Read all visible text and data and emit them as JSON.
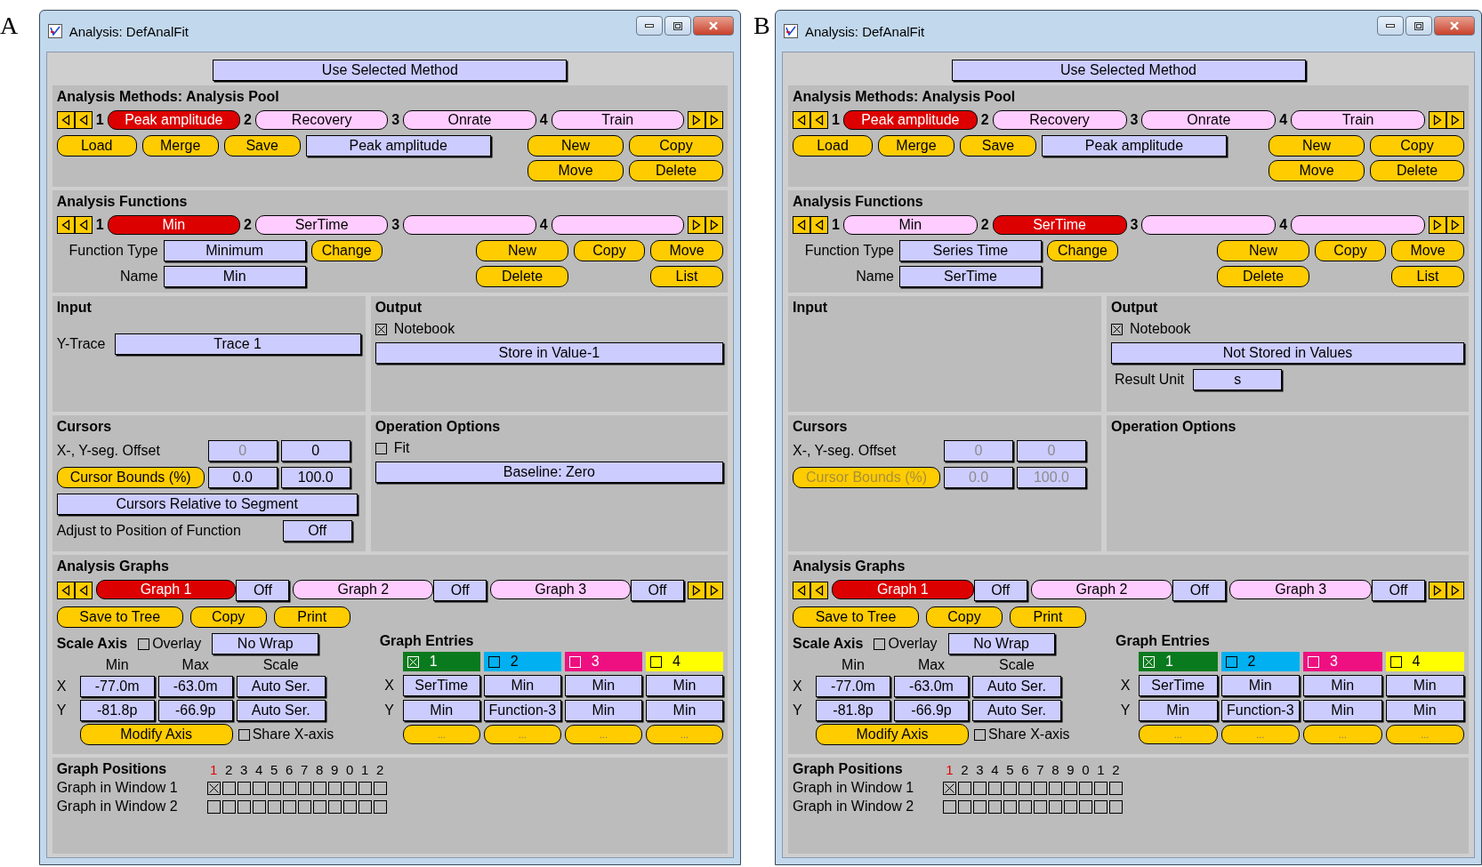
{
  "panels": [
    {
      "label": "A",
      "title": "Analysis:  DefAnalFit",
      "use_method_button": "Use Selected Method",
      "methods": {
        "heading": "Analysis Methods:  Analysis Pool",
        "slots": [
          {
            "number": "1",
            "name": "Peak amplitude",
            "selected": true
          },
          {
            "number": "2",
            "name": "Recovery",
            "selected": false
          },
          {
            "number": "3",
            "name": "Onrate",
            "selected": false
          },
          {
            "number": "4",
            "name": "Train",
            "selected": false
          }
        ],
        "file_buttons": [
          "Load",
          "Merge",
          "Save"
        ],
        "current_name": "Peak amplitude",
        "actions": [
          "New",
          "Copy",
          "Move",
          "Delete"
        ]
      },
      "functions": {
        "heading": "Analysis Functions",
        "slots": [
          {
            "number": "1",
            "name": "Min",
            "selected": true
          },
          {
            "number": "2",
            "name": "SerTime",
            "selected": false
          },
          {
            "number": "3",
            "selected": false
          },
          {
            "number": "4",
            "selected": false
          }
        ],
        "type_label": "Function Type",
        "type_value": "Minimum",
        "change_button": "Change",
        "name_label": "Name",
        "name_value": "Min",
        "actions": [
          "New",
          "Copy",
          "Move",
          "Delete",
          "List"
        ]
      },
      "input": {
        "heading": "Input",
        "fields": [
          {
            "label": "Y-Trace",
            "value": "Trace 1"
          }
        ]
      },
      "output": {
        "heading": "Output",
        "notebook": {
          "label": "Notebook",
          "checked": true
        },
        "store_button": "Store in Value-1"
      },
      "cursors": {
        "heading": "Cursors",
        "offset_label": "X-, Y-seg. Offset",
        "offset_values": [
          {
            "value": "0",
            "disabled": true
          },
          {
            "value": "0",
            "disabled": false
          }
        ],
        "bounds_button": {
          "label": "Cursor Bounds (%)",
          "disabled": false
        },
        "bounds_values": [
          {
            "value": "0.0",
            "disabled": false
          },
          {
            "value": "100.0",
            "disabled": false
          }
        ],
        "relative_button": "Cursors Relative to Segment",
        "adjust": {
          "label": "Adjust to Position of Function",
          "value": "Off"
        }
      },
      "operation": {
        "heading": "Operation Options",
        "fit": {
          "label": "Fit",
          "checked": false
        },
        "baseline_button": "Baseline: Zero"
      },
      "graphs": {
        "heading": "Analysis Graphs",
        "tabs": [
          {
            "name": "Graph 1",
            "toggle": "Off",
            "selected": true
          },
          {
            "name": "Graph 2",
            "toggle": "Off",
            "selected": false
          },
          {
            "name": "Graph 3",
            "toggle": "Off",
            "selected": false
          }
        ],
        "buttons": [
          "Save to Tree",
          "Copy",
          "Print"
        ],
        "scale": {
          "heading": "Scale Axis",
          "overlay": {
            "label": "Overlay",
            "checked": false
          },
          "wrap_button": "No Wrap",
          "columns": [
            "Min",
            "Max",
            "Scale"
          ],
          "rows": [
            {
              "axis": "X",
              "values": [
                "-77.0m",
                "-63.0m",
                "Auto Ser."
              ]
            },
            {
              "axis": "Y",
              "values": [
                "-81.8p",
                "-66.9p",
                "Auto Ser."
              ]
            }
          ],
          "modify_button": "Modify Axis",
          "share": {
            "label": "Share X-axis",
            "checked": false
          }
        },
        "entries": {
          "heading": "Graph Entries",
          "axes": [
            "X",
            "Y"
          ],
          "items": [
            {
              "number": "1",
              "checked": true,
              "color": "#0a7a1e",
              "x": "SerTime",
              "y": "Min",
              "more": "..."
            },
            {
              "number": "2",
              "checked": false,
              "color": "#00b0f0",
              "x": "Min",
              "y": "Function-3",
              "more": "..."
            },
            {
              "number": "3",
              "checked": false,
              "color": "#ee1080",
              "x": "Min",
              "y": "Min",
              "more": "..."
            },
            {
              "number": "4",
              "checked": false,
              "color": "#ffff00",
              "x": "Min",
              "y": "Min",
              "more": "..."
            }
          ]
        }
      },
      "positions": {
        "heading": "Graph Positions",
        "numbers": [
          {
            "text": "1",
            "current": true
          },
          {
            "text": "2",
            "current": false
          },
          {
            "text": "3",
            "current": false
          },
          {
            "text": "4",
            "current": false
          },
          {
            "text": "5",
            "current": false
          },
          {
            "text": "6",
            "current": false
          },
          {
            "text": "7",
            "current": false
          },
          {
            "text": "8",
            "current": false
          },
          {
            "text": "9",
            "current": false
          },
          {
            "text": "0",
            "current": false
          },
          {
            "text": "1",
            "current": false
          },
          {
            "text": "2",
            "current": false
          }
        ],
        "rows": [
          {
            "label": "Graph in Window 1",
            "boxes": [
              {
                "checked": true
              },
              {
                "checked": false
              },
              {
                "checked": false
              },
              {
                "checked": false
              },
              {
                "checked": false
              },
              {
                "checked": false
              },
              {
                "checked": false
              },
              {
                "checked": false
              },
              {
                "checked": false
              },
              {
                "checked": false
              },
              {
                "checked": false
              },
              {
                "checked": false
              }
            ]
          },
          {
            "label": "Graph in Window 2",
            "boxes": [
              {
                "checked": false
              },
              {
                "checked": false
              },
              {
                "checked": false
              },
              {
                "checked": false
              },
              {
                "checked": false
              },
              {
                "checked": false
              },
              {
                "checked": false
              },
              {
                "checked": false
              },
              {
                "checked": false
              },
              {
                "checked": false
              },
              {
                "checked": false
              },
              {
                "checked": false
              }
            ]
          }
        ]
      }
    },
    {
      "label": "B",
      "title": "Analysis:  DefAnalFit",
      "use_method_button": "Use Selected Method",
      "methods": {
        "heading": "Analysis Methods:  Analysis Pool",
        "slots": [
          {
            "number": "1",
            "name": "Peak amplitude",
            "selected": true
          },
          {
            "number": "2",
            "name": "Recovery",
            "selected": false
          },
          {
            "number": "3",
            "name": "Onrate",
            "selected": false
          },
          {
            "number": "4",
            "name": "Train",
            "selected": false
          }
        ],
        "file_buttons": [
          "Load",
          "Merge",
          "Save"
        ],
        "current_name": "Peak amplitude",
        "actions": [
          "New",
          "Copy",
          "Move",
          "Delete"
        ]
      },
      "functions": {
        "heading": "Analysis Functions",
        "slots": [
          {
            "number": "1",
            "name": "Min",
            "selected": false
          },
          {
            "number": "2",
            "name": "SerTime",
            "selected": true
          },
          {
            "number": "3",
            "selected": false
          },
          {
            "number": "4",
            "selected": false
          }
        ],
        "type_label": "Function Type",
        "type_value": "Series Time",
        "change_button": "Change",
        "name_label": "Name",
        "name_value": "SerTime",
        "actions": [
          "New",
          "Copy",
          "Move",
          "Delete",
          "List"
        ]
      },
      "input": {
        "heading": "Input"
      },
      "output": {
        "heading": "Output",
        "notebook": {
          "label": "Notebook",
          "checked": true
        },
        "store_button": "Not Stored in Values",
        "result_unit": {
          "label": "Result Unit",
          "value": "s"
        }
      },
      "cursors": {
        "heading": "Cursors",
        "offset_label": "X-, Y-seg. Offset",
        "offset_values": [
          {
            "value": "0",
            "disabled": true
          },
          {
            "value": "0",
            "disabled": true
          }
        ],
        "bounds_button": {
          "label": "Cursor Bounds (%)",
          "disabled": true
        },
        "bounds_values": [
          {
            "value": "0.0",
            "disabled": true
          },
          {
            "value": "100.0",
            "disabled": true
          }
        ]
      },
      "operation": {
        "heading": "Operation Options"
      },
      "graphs": {
        "heading": "Analysis Graphs",
        "tabs": [
          {
            "name": "Graph 1",
            "toggle": "Off",
            "selected": true
          },
          {
            "name": "Graph 2",
            "toggle": "Off",
            "selected": false
          },
          {
            "name": "Graph 3",
            "toggle": "Off",
            "selected": false
          }
        ],
        "buttons": [
          "Save to Tree",
          "Copy",
          "Print"
        ],
        "scale": {
          "heading": "Scale Axis",
          "overlay": {
            "label": "Overlay",
            "checked": false
          },
          "wrap_button": "No Wrap",
          "columns": [
            "Min",
            "Max",
            "Scale"
          ],
          "rows": [
            {
              "axis": "X",
              "values": [
                "-77.0m",
                "-63.0m",
                "Auto Ser."
              ]
            },
            {
              "axis": "Y",
              "values": [
                "-81.8p",
                "-66.9p",
                "Auto Ser."
              ]
            }
          ],
          "modify_button": "Modify Axis",
          "share": {
            "label": "Share X-axis",
            "checked": false
          }
        },
        "entries": {
          "heading": "Graph Entries",
          "axes": [
            "X",
            "Y"
          ],
          "items": [
            {
              "number": "1",
              "checked": true,
              "color": "#0a7a1e",
              "x": "SerTime",
              "y": "Min",
              "more": "..."
            },
            {
              "number": "2",
              "checked": false,
              "color": "#00b0f0",
              "x": "Min",
              "y": "Function-3",
              "more": "..."
            },
            {
              "number": "3",
              "checked": false,
              "color": "#ee1080",
              "x": "Min",
              "y": "Min",
              "more": "..."
            },
            {
              "number": "4",
              "checked": false,
              "color": "#ffff00",
              "x": "Min",
              "y": "Min",
              "more": "..."
            }
          ]
        }
      },
      "positions": {
        "heading": "Graph Positions",
        "numbers": [
          {
            "text": "1",
            "current": true
          },
          {
            "text": "2",
            "current": false
          },
          {
            "text": "3",
            "current": false
          },
          {
            "text": "4",
            "current": false
          },
          {
            "text": "5",
            "current": false
          },
          {
            "text": "6",
            "current": false
          },
          {
            "text": "7",
            "current": false
          },
          {
            "text": "8",
            "current": false
          },
          {
            "text": "9",
            "current": false
          },
          {
            "text": "0",
            "current": false
          },
          {
            "text": "1",
            "current": false
          },
          {
            "text": "2",
            "current": false
          }
        ],
        "rows": [
          {
            "label": "Graph in Window 1",
            "boxes": [
              {
                "checked": true
              },
              {
                "checked": false
              },
              {
                "checked": false
              },
              {
                "checked": false
              },
              {
                "checked": false
              },
              {
                "checked": false
              },
              {
                "checked": false
              },
              {
                "checked": false
              },
              {
                "checked": false
              },
              {
                "checked": false
              },
              {
                "checked": false
              },
              {
                "checked": false
              }
            ]
          },
          {
            "label": "Graph in Window 2",
            "boxes": [
              {
                "checked": false
              },
              {
                "checked": false
              },
              {
                "checked": false
              },
              {
                "checked": false
              },
              {
                "checked": false
              },
              {
                "checked": false
              },
              {
                "checked": false
              },
              {
                "checked": false
              },
              {
                "checked": false
              },
              {
                "checked": false
              },
              {
                "checked": false
              },
              {
                "checked": false
              }
            ]
          }
        ]
      }
    }
  ]
}
